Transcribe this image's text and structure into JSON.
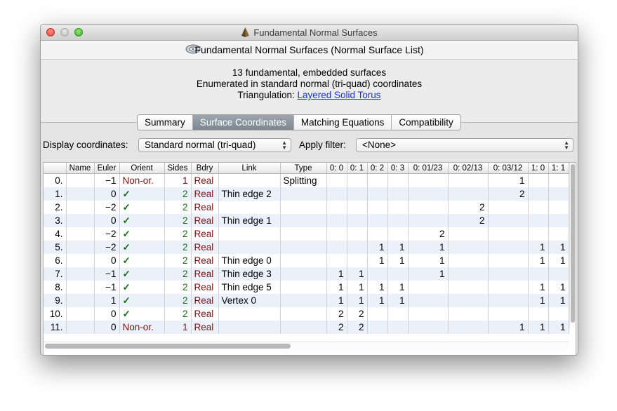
{
  "window": {
    "title": "Fundamental Normal Surfaces",
    "subtitle": "Fundamental Normal Surfaces (Normal Surface List)"
  },
  "info": {
    "line1": "13 fundamental, embedded surfaces",
    "line2": "Enumerated in standard normal (tri-quad) coordinates",
    "triangulation_label": "Triangulation:",
    "triangulation_link": "Layered Solid Torus"
  },
  "tabs": [
    {
      "label": "Summary",
      "active": false
    },
    {
      "label": "Surface Coordinates",
      "active": true
    },
    {
      "label": "Matching Equations",
      "active": false
    },
    {
      "label": "Compatibility",
      "active": false
    }
  ],
  "controls": {
    "display_label": "Display coordinates:",
    "display_value": "Standard normal (tri-quad)",
    "filter_label": "Apply filter:",
    "filter_value": "<None>"
  },
  "table": {
    "columns": [
      "",
      "Name",
      "Euler",
      "Orient",
      "Sides",
      "Bdry",
      "Link",
      "Type",
      "0: 0",
      "0: 1",
      "0: 2",
      "0: 3",
      "0: 01/23",
      "0: 02/13",
      "0: 03/12",
      "1: 0",
      "1: 1"
    ],
    "rows": [
      [
        "0.",
        "",
        "−1",
        "Non-or.",
        "1",
        "Real",
        "",
        "Splitting",
        "",
        "",
        "",
        "",
        "",
        "",
        "1",
        "",
        ""
      ],
      [
        "1.",
        "",
        "0",
        "✓",
        "2",
        "Real",
        "Thin edge 2",
        "",
        "",
        "",
        "",
        "",
        "",
        "",
        "2",
        "",
        ""
      ],
      [
        "2.",
        "",
        "−2",
        "✓",
        "2",
        "Real",
        "",
        "",
        "",
        "",
        "",
        "",
        "",
        "2",
        "",
        "",
        ""
      ],
      [
        "3.",
        "",
        "0",
        "✓",
        "2",
        "Real",
        "Thin edge 1",
        "",
        "",
        "",
        "",
        "",
        "",
        "2",
        "",
        "",
        ""
      ],
      [
        "4.",
        "",
        "−2",
        "✓",
        "2",
        "Real",
        "",
        "",
        "",
        "",
        "",
        "",
        "2",
        "",
        "",
        "",
        ""
      ],
      [
        "5.",
        "",
        "−2",
        "✓",
        "2",
        "Real",
        "",
        "",
        "",
        "",
        "1",
        "1",
        "1",
        "",
        "",
        "1",
        "1"
      ],
      [
        "6.",
        "",
        "0",
        "✓",
        "2",
        "Real",
        "Thin edge 0",
        "",
        "",
        "",
        "1",
        "1",
        "1",
        "",
        "",
        "1",
        "1"
      ],
      [
        "7.",
        "",
        "−1",
        "✓",
        "2",
        "Real",
        "Thin edge 3",
        "",
        "1",
        "1",
        "",
        "",
        "1",
        "",
        "",
        "",
        ""
      ],
      [
        "8.",
        "",
        "−1",
        "✓",
        "2",
        "Real",
        "Thin edge 5",
        "",
        "1",
        "1",
        "1",
        "1",
        "",
        "",
        "",
        "1",
        "1"
      ],
      [
        "9.",
        "",
        "1",
        "✓",
        "2",
        "Real",
        "Vertex 0",
        "",
        "1",
        "1",
        "1",
        "1",
        "",
        "",
        "",
        "1",
        "1"
      ],
      [
        "10.",
        "",
        "0",
        "✓",
        "2",
        "Real",
        "",
        "",
        "2",
        "2",
        "",
        "",
        "",
        "",
        "",
        "",
        ""
      ],
      [
        "11.",
        "",
        "0",
        "Non-or.",
        "1",
        "Real",
        "",
        "",
        "2",
        "2",
        "",
        "",
        "",
        "",
        "1",
        "1",
        "1"
      ]
    ]
  },
  "colors": {
    "accent_red": "#7b1010",
    "accent_green": "#157015",
    "link_blue": "#1b33cc",
    "row_alt": "#ebf1fb"
  },
  "icons": [
    "app-icon",
    "normal-surface-list-icon",
    "popup-arrows-icon"
  ]
}
